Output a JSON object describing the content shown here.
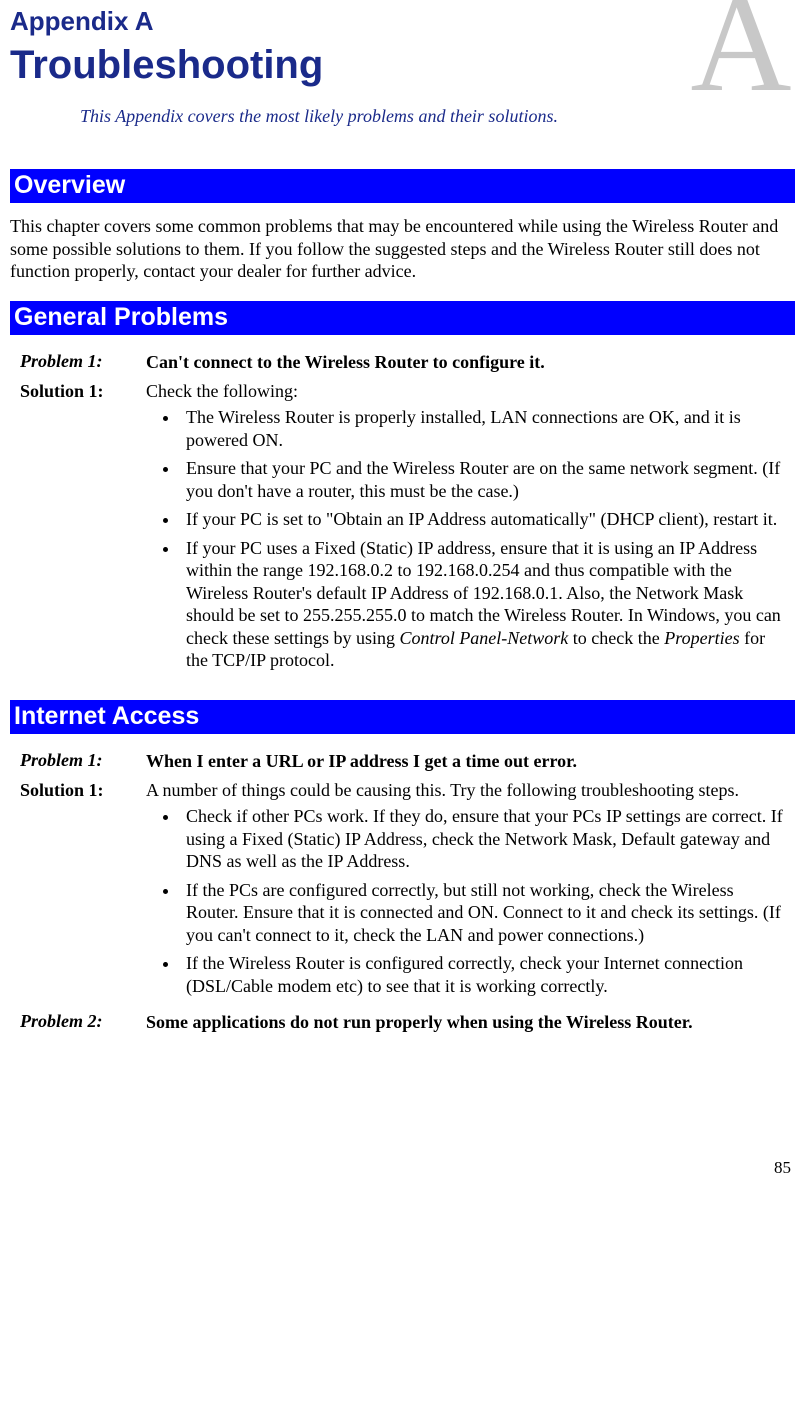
{
  "header": {
    "appendix_label": "Appendix A",
    "title": "Troubleshooting",
    "subtitle": "This Appendix covers the most likely problems and their solutions.",
    "big_letter": "A"
  },
  "sections": {
    "overview": {
      "heading": "Overview",
      "paragraph": "This chapter covers some common problems that may be encountered while using the Wireless Router and some possible solutions to them. If you follow the suggested steps and the Wireless Router still does not function properly, contact your dealer for further advice."
    },
    "general": {
      "heading": "General Problems",
      "problem1_label": "Problem 1:",
      "problem1_text": "Can't connect to the Wireless Router to configure it.",
      "solution1_label": "Solution 1:",
      "solution1_intro": "Check the following:",
      "solution1_bullets": [
        "The Wireless Router is properly installed, LAN connections are OK, and it is powered ON.",
        "Ensure that your PC and the Wireless Router are on the same network segment. (If you don't have a router, this must be the case.)",
        "If your PC is set to \"Obtain an IP Address automatically\" (DHCP client), restart it.",
        "If your PC uses a Fixed (Static) IP address, ensure that it is using an IP Address within the range 192.168.0.2 to 192.168.0.254 and thus compatible with the Wireless Router's default IP Address of 192.168.0.1. Also, the Network Mask should be set to 255.255.255.0 to match the Wireless Router.\nIn Windows, you can check these settings by using "
      ],
      "solution1_tail_italic1": "Control Panel-Network",
      "solution1_tail_mid": " to check the ",
      "solution1_tail_italic2": "Properties",
      "solution1_tail_end": " for the TCP/IP protocol."
    },
    "internet": {
      "heading": "Internet Access",
      "problem1_label": "Problem 1:",
      "problem1_text": "When I enter a URL or IP address I get a time out error.",
      "solution1_label": "Solution 1:",
      "solution1_intro": "A number of things could be causing this. Try the following troubleshooting steps.",
      "solution1_bullets": [
        "Check if other PCs work. If they do, ensure that your PCs IP settings are correct. If using a Fixed (Static) IP Address, check the Network Mask, Default gateway and DNS as well as the IP Address.",
        "If the PCs are configured correctly, but still not working, check the Wireless Router. Ensure that it is connected and ON. Connect to it and check its settings. (If you can't connect to it, check the LAN and power connections.)",
        "If the Wireless Router is configured correctly, check your Internet connection (DSL/Cable modem etc) to see that it is working correctly."
      ],
      "problem2_label": "Problem 2:",
      "problem2_text": "Some applications do not run properly when using the Wireless Router."
    }
  },
  "page_number": "85"
}
